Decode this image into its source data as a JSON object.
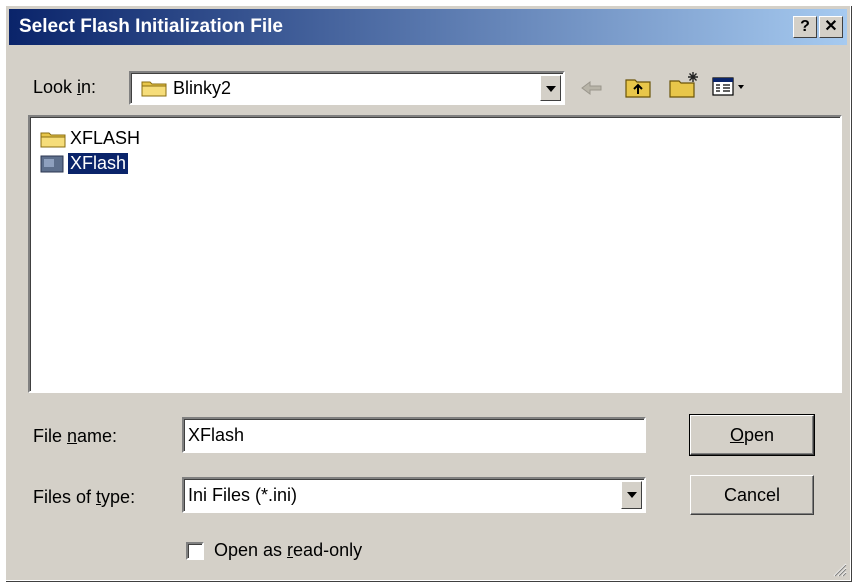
{
  "window": {
    "title": "Select Flash Initialization File",
    "help_label": "?",
    "close_label": "✕"
  },
  "look_in": {
    "label_pre": "Look ",
    "label_key": "i",
    "label_post": "n:",
    "value": "Blinky2"
  },
  "toolbar": {
    "icons": [
      "back-icon",
      "up-folder-icon",
      "new-folder-icon",
      "view-menu-icon"
    ]
  },
  "files": [
    {
      "name": "XFLASH",
      "type": "folder",
      "selected": false
    },
    {
      "name": "XFlash",
      "type": "ini-file",
      "selected": true
    }
  ],
  "file_name": {
    "label_pre": "File ",
    "label_key": "n",
    "label_post": "ame:",
    "value": "XFlash"
  },
  "file_type": {
    "label_pre": "Files of ",
    "label_key": "t",
    "label_post": "ype:",
    "value": "Ini Files (*.ini)"
  },
  "buttons": {
    "open_key": "O",
    "open_rest": "pen",
    "cancel": "Cancel"
  },
  "readonly": {
    "label_pre": "Open as ",
    "label_key": "r",
    "label_post": "ead-only",
    "checked": false
  },
  "colors": {
    "titlebar_start": "#0a246a",
    "titlebar_end": "#a6caf0",
    "face": "#d4d0c8"
  }
}
